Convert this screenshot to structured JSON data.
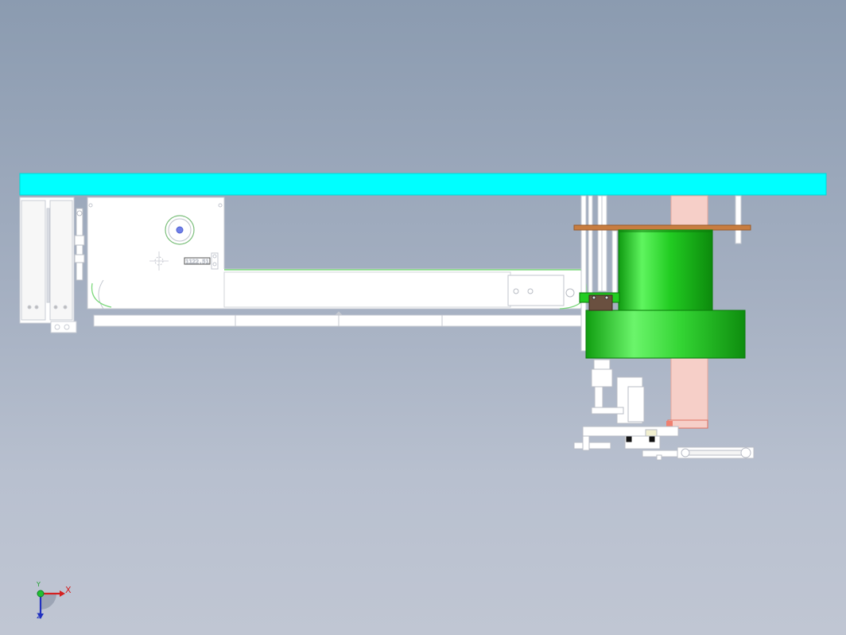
{
  "viewport": {
    "background_top": "#8b9bb0",
    "background_bottom": "#c0c6d3"
  },
  "model": {
    "beam_color": "#00ffff",
    "flange_color": "#c87d40",
    "cylinder_color": "#22cc22",
    "column_color": "#f4c8c0",
    "parts_color": "#ffffff",
    "block_color": "#6a5040",
    "nameplate_text": "1122.51"
  },
  "triad": {
    "x_label": "X",
    "y_label": "Y",
    "z_label": "Z",
    "x_color": "#d42020",
    "y_color": "#20a030",
    "z_color": "#2030c0"
  }
}
